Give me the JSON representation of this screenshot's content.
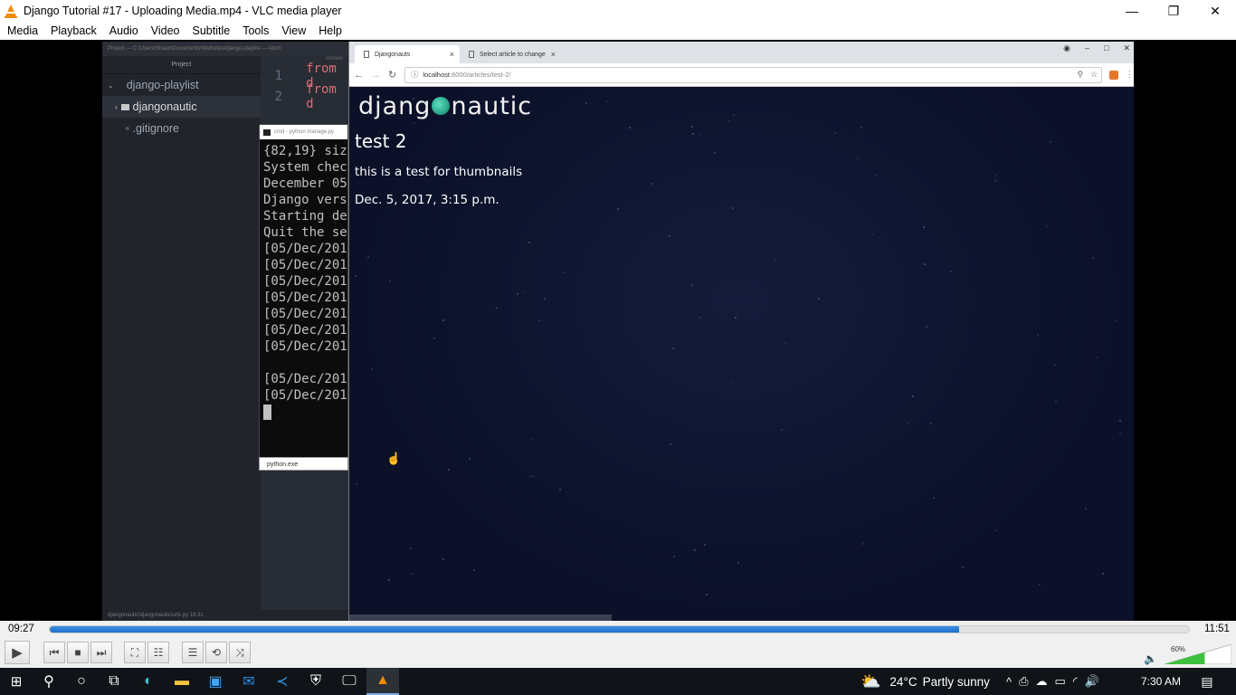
{
  "window": {
    "title": "Django Tutorial #17 - Uploading Media.mp4 - VLC media player",
    "minimize": "—",
    "maximize": "❐",
    "close": "✕"
  },
  "menu": [
    {
      "label": "Media"
    },
    {
      "label": "Playback"
    },
    {
      "label": "Audio"
    },
    {
      "label": "Video"
    },
    {
      "label": "Subtitle"
    },
    {
      "label": "Tools"
    },
    {
      "label": "View"
    },
    {
      "label": "Help"
    }
  ],
  "atom": {
    "title": "Project — C:\\Users\\Shaun\\Documents\\Websites\\django-playlist — Atom",
    "tree_header": "Project",
    "tab_hint": "models",
    "tree": [
      {
        "label": "django-playlist"
      },
      {
        "label": "djangonautic"
      },
      {
        "label": ".gitignore"
      }
    ],
    "code": [
      {
        "num": "1",
        "text": "from d"
      },
      {
        "num": "2",
        "text": "from d"
      }
    ],
    "status": "djangonautic\\djangonautic\\urls.py    16:31"
  },
  "cmd": {
    "title": "cmd - python  manage.py",
    "lines": [
      "{82,19} siz",
      "System chec",
      "December 05",
      "Django vers",
      "Starting de",
      "Quit the se",
      "[05/Dec/201",
      "[05/Dec/201",
      "[05/Dec/201",
      "[05/Dec/201",
      "[05/Dec/201",
      "[05/Dec/201",
      "[05/Dec/201",
      "",
      "[05/Dec/201",
      "[05/Dec/201"
    ],
    "taskbar_label": "python.exe"
  },
  "browser": {
    "tabs": [
      {
        "label": "Djangonauts",
        "close": "×"
      },
      {
        "label": "Select article to change",
        "close": "×"
      }
    ],
    "url_host": "localhost",
    "url_rest": ":8000/articles/test-2/",
    "page": {
      "brand_left": "djang",
      "brand_right": "nautic",
      "article_title": "test 2",
      "article_body": "this is a test for thumbnails",
      "article_date": "Dec. 5, 2017, 3:15 p.m."
    }
  },
  "player": {
    "elapsed": "09:27",
    "total": "11:51",
    "progress_fraction": 0.798,
    "volume_label": "60%",
    "volume_fraction": 0.6
  },
  "taskbar": {
    "temperature": "24°C",
    "weather": "Partly sunny",
    "time": "7:30 AM"
  },
  "colors": {
    "seek_fill": "#1e6fc8",
    "volume_fill": "#3ec13e",
    "page_bg": "#0e1430",
    "brand_accent": "#2aa88c"
  }
}
